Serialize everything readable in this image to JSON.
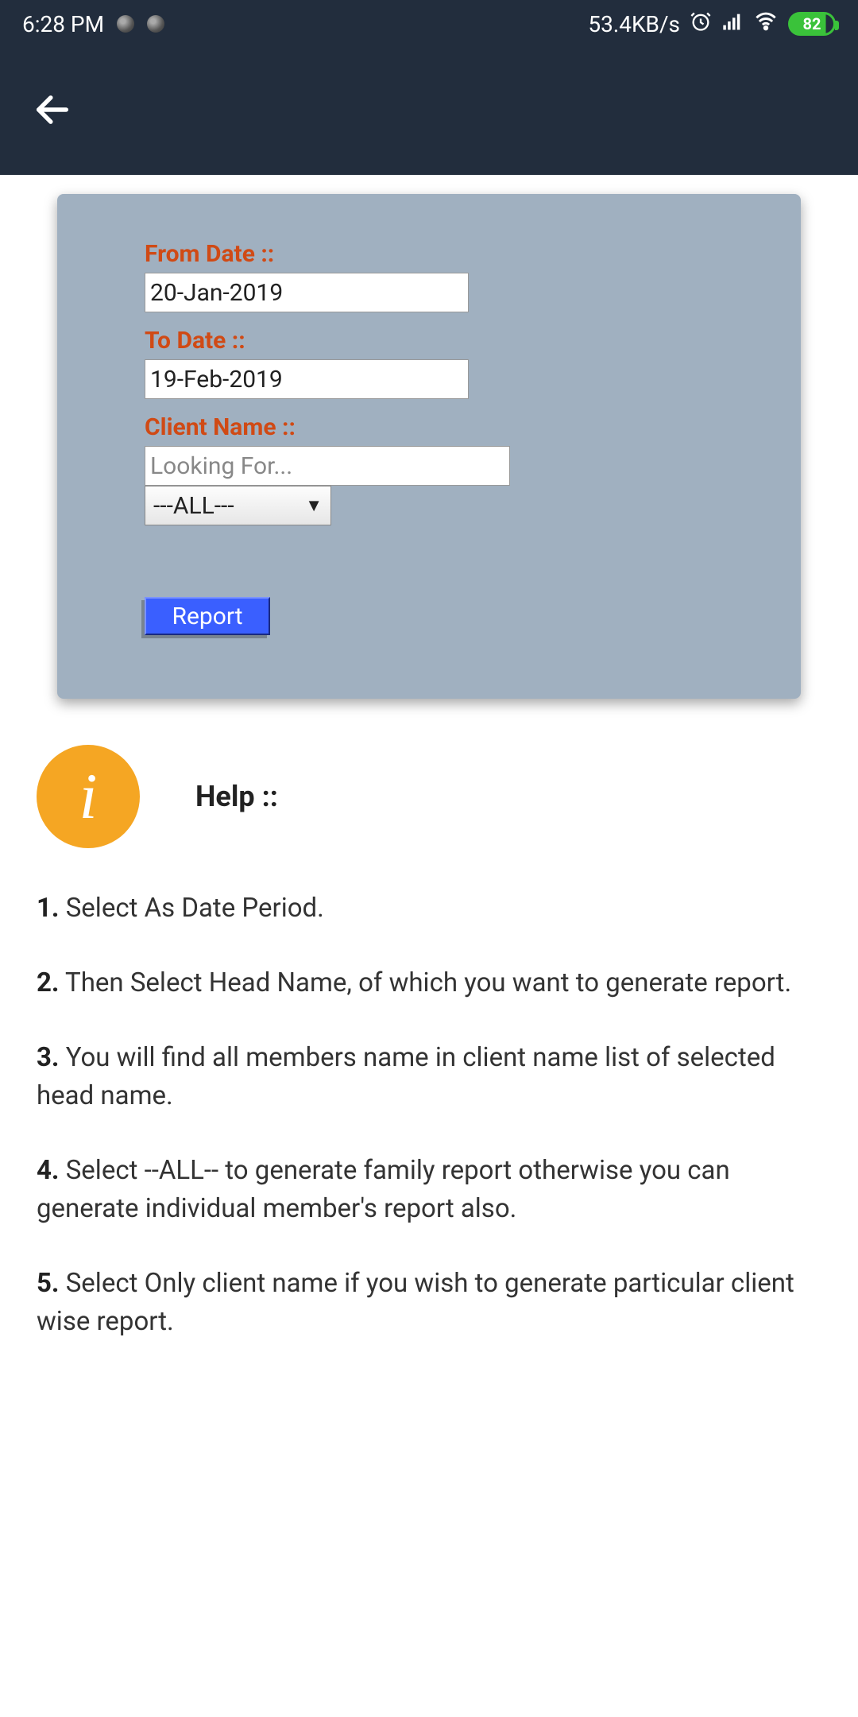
{
  "status": {
    "time": "6:28 PM",
    "speed": "53.4KB/s",
    "battery": "82"
  },
  "form": {
    "from_label": "From Date ::",
    "from_value": "20-Jan-2019",
    "to_label": "To Date ::",
    "to_value": "19-Feb-2019",
    "client_label": "Client Name ::",
    "client_placeholder": "Looking For...",
    "select_value": "---ALL---",
    "report_label": "Report"
  },
  "help": {
    "title": "Help ::",
    "items": [
      {
        "num": "1.",
        "text": " Select As Date Period."
      },
      {
        "num": "2.",
        "text": " Then Select Head Name, of which you want to generate report."
      },
      {
        "num": "3.",
        "text": " You will find all members name in client name list of selected head name."
      },
      {
        "num": "4.",
        "text": " Select --ALL-- to generate family report otherwise you can generate individual member's report also."
      },
      {
        "num": "5.",
        "text": " Select Only client name if you wish to generate particular client wise report."
      }
    ]
  }
}
